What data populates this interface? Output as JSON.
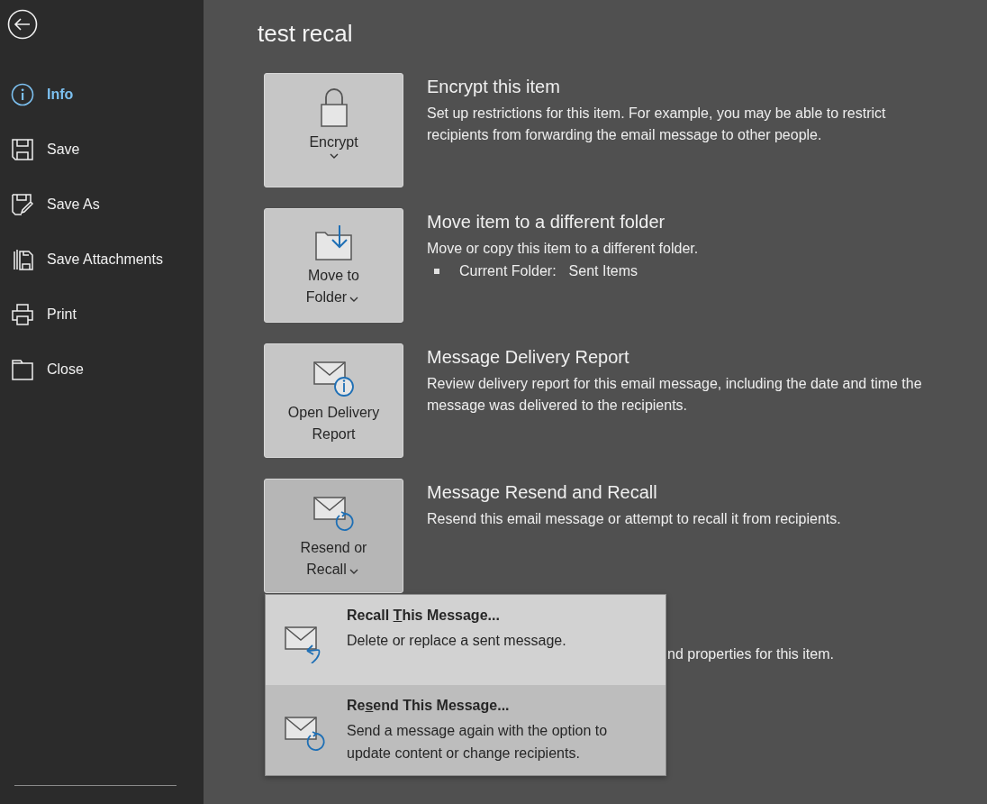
{
  "sidebar": {
    "items": [
      {
        "label": "Info",
        "selected": true
      },
      {
        "label": "Save",
        "selected": false
      },
      {
        "label": "Save As",
        "selected": false
      },
      {
        "label": "Save Attachments",
        "selected": false
      },
      {
        "label": "Print",
        "selected": false
      },
      {
        "label": "Close",
        "selected": false
      }
    ]
  },
  "title": "test recal",
  "sections": [
    {
      "kind": "full",
      "button": [
        "Encrypt"
      ],
      "dropdown": true,
      "selected": false,
      "heading": "Encrypt this item",
      "description": "Set up restrictions for this item. For example, you may be able to restrict recipients from forwarding the email message to other people."
    },
    {
      "kind": "full",
      "button": [
        "Move to",
        "Folder"
      ],
      "dropdown": true,
      "selected": false,
      "heading": "Move item to a different folder",
      "description": "Move or copy this item to a different folder.",
      "bullet": {
        "label": "Current Folder:",
        "value": "Sent Items"
      }
    },
    {
      "kind": "full",
      "button": [
        "Open Delivery",
        "Report"
      ],
      "dropdown": false,
      "selected": false,
      "heading": "Message Delivery Report",
      "description": "Review delivery report for this email message, including the date and time the message was delivered to the recipients."
    },
    {
      "kind": "full",
      "button": [
        "Resend or",
        "Recall"
      ],
      "dropdown": true,
      "selected": true,
      "heading": "Message Resend and Recall",
      "description": "Resend this email message or attempt to recall it from recipients."
    },
    {
      "kind": "partial",
      "description": "nd properties for this item."
    }
  ],
  "menu": [
    {
      "before": "Recall ",
      "key": "T",
      "after": "his Message...",
      "description": "Delete or replace a sent message.",
      "selected": false
    },
    {
      "before": "Re",
      "key": "s",
      "after": "end This Message...",
      "description": "Send a message again with the option to update content or change recipients.",
      "selected": true
    }
  ]
}
